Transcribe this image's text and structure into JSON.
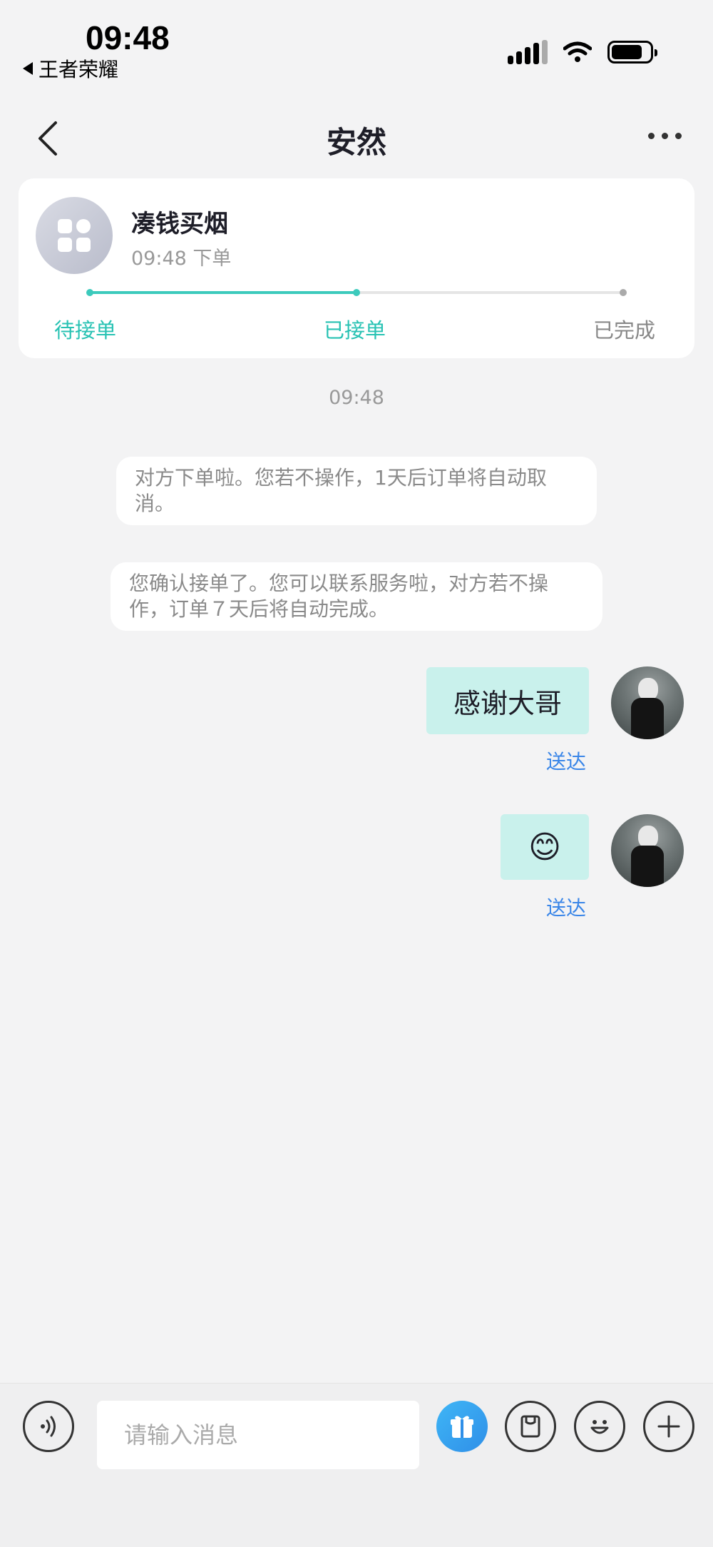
{
  "status_bar": {
    "time": "09:48",
    "back_app": "王者荣耀",
    "battery_level": 0.8
  },
  "header": {
    "title": "安然"
  },
  "order": {
    "name": "凑钱买烟",
    "time": "09:48 下单",
    "steps": [
      "待接单",
      "已接单",
      "已完成"
    ],
    "progress": 0.5
  },
  "chat": {
    "timestamp": "09:48",
    "system_messages": [
      "对方下单啦。您若不操作，1天后订单将自动取消。",
      "您确认接单了。您可以联系服务啦，对方若不操作，订单７天后将自动完成。"
    ],
    "messages": [
      {
        "text": "感谢大哥",
        "status": "送达"
      },
      {
        "text": "😊",
        "status": "送达"
      }
    ]
  },
  "input_bar": {
    "placeholder": "请输入消息",
    "icons": [
      "voice-icon",
      "gift-icon",
      "card-icon",
      "emoji-icon",
      "plus-icon"
    ]
  },
  "colors": {
    "accent": "#27c2b3",
    "bubble": "#c9f1ec",
    "delivered": "#3a86e8",
    "gift": "#2f8fe8"
  }
}
